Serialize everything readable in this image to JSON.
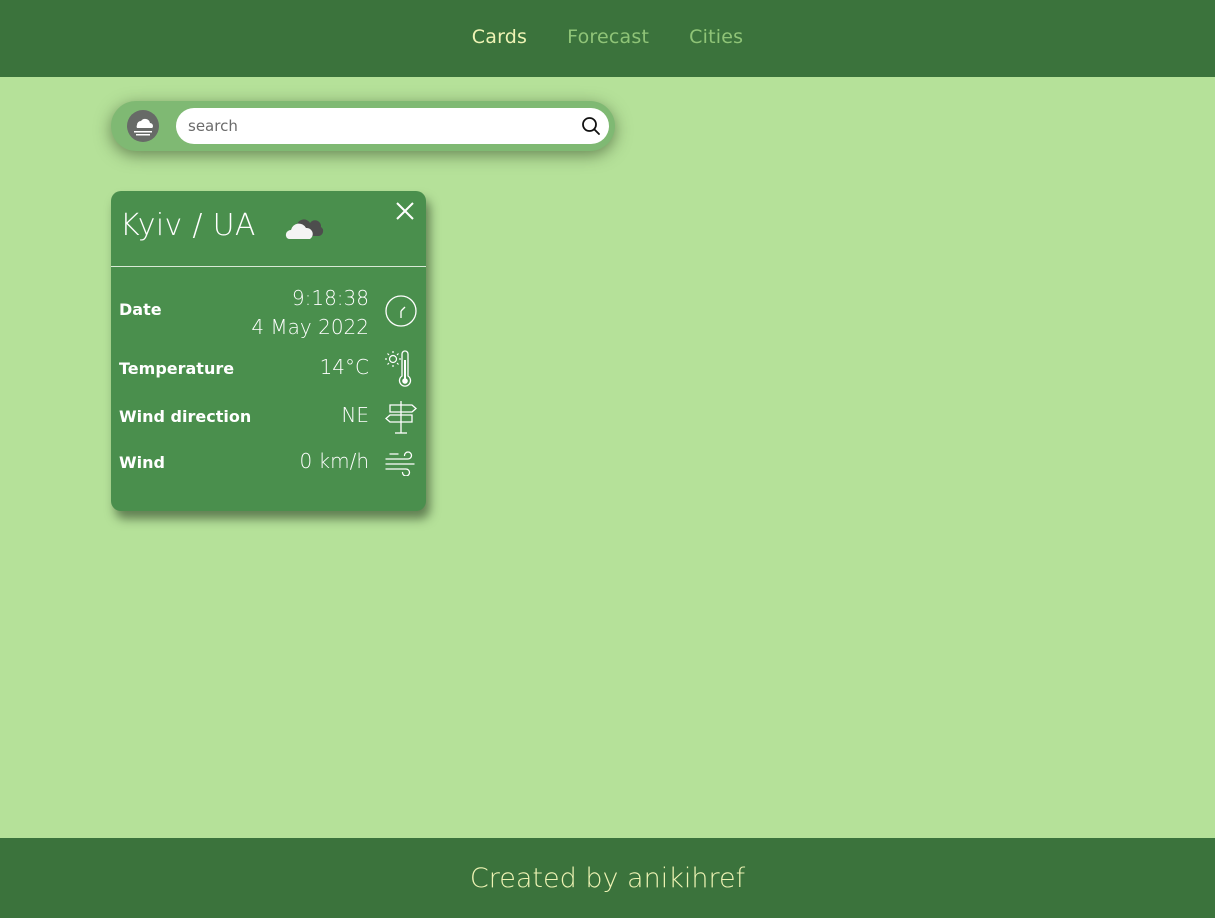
{
  "nav": {
    "items": [
      {
        "label": "Cards",
        "active": true
      },
      {
        "label": "Forecast",
        "active": false
      },
      {
        "label": "Cities",
        "active": false
      }
    ]
  },
  "search": {
    "placeholder": "search",
    "value": "",
    "weather_icon": "fog-icon",
    "search_icon": "search-icon"
  },
  "card": {
    "title": "Kyiv / UA",
    "condition_icon": "cloudy-icon",
    "rows": [
      {
        "label": "Date",
        "value_line1": "9:18:38",
        "value_line2": "4 May 2022",
        "icon": "clock-icon"
      },
      {
        "label": "Temperature",
        "value": "14°C",
        "icon": "thermometer-icon"
      },
      {
        "label": "Wind direction",
        "value": "NE",
        "icon": "signpost-icon"
      },
      {
        "label": "Wind",
        "value": "0 km/h",
        "icon": "wind-icon"
      }
    ]
  },
  "footer": {
    "text": "Created by anikihref"
  },
  "colors": {
    "header_bg": "#3b733c",
    "page_bg": "#b5e199",
    "card_bg": "#4a8f4d",
    "search_bar_bg": "#7fb973",
    "active_nav": "#eef3b4",
    "inactive_nav": "#8fc477"
  }
}
